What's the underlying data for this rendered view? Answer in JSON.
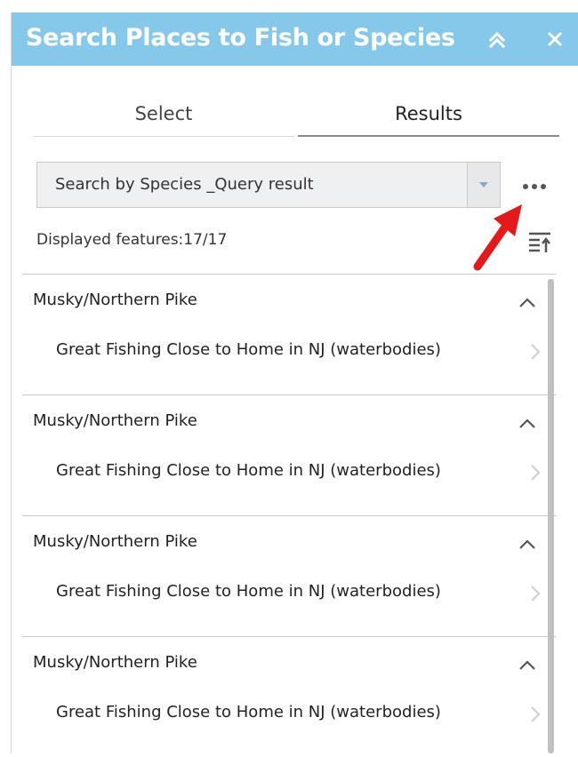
{
  "panel": {
    "title": "Search Places to Fish or Species",
    "accent_color": "#85c8ea",
    "collapse_icon": "double-chevron-up-icon",
    "close_icon": "close-icon"
  },
  "tabs": [
    {
      "label": "Select",
      "active": false
    },
    {
      "label": "Results",
      "active": true
    }
  ],
  "query": {
    "selected": "Search by Species _Query result",
    "dropdown_icon": "caret-down-icon",
    "more_icon": "more-horizontal-icon"
  },
  "annotation": {
    "arrow_color": "#e3191b"
  },
  "features": {
    "label": "Displayed features:17/17",
    "sort_icon": "sort-icon"
  },
  "results": [
    {
      "header": "Musky/Northern Pike",
      "item": "Great Fishing Close to Home in NJ (waterbodies)"
    },
    {
      "header": "Musky/Northern Pike",
      "item": "Great Fishing Close to Home in NJ (waterbodies)"
    },
    {
      "header": "Musky/Northern Pike",
      "item": "Great Fishing Close to Home in NJ (waterbodies)"
    },
    {
      "header": "Musky/Northern Pike",
      "item": "Great Fishing Close to Home in NJ (waterbodies)"
    }
  ]
}
